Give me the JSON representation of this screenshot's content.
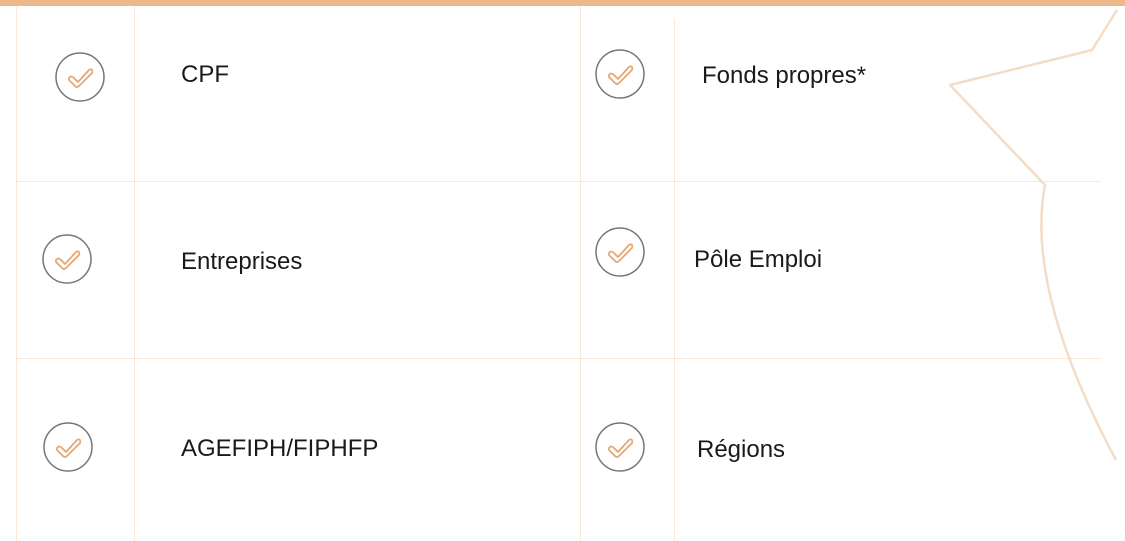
{
  "colors": {
    "accent": "#EDB98A",
    "check_stroke": "#E6A872",
    "circle_stroke": "#767676",
    "grid_line": "#F8E9D9",
    "text": "#1a1a1a"
  },
  "icon": "check-circle-icon",
  "funding_options": [
    {
      "label": "CPF"
    },
    {
      "label": "Fonds propres*"
    },
    {
      "label": "Entreprises"
    },
    {
      "label": "Pôle Emploi"
    },
    {
      "label": "AGEFIPH/FIPHFP"
    },
    {
      "label": "Régions"
    }
  ]
}
